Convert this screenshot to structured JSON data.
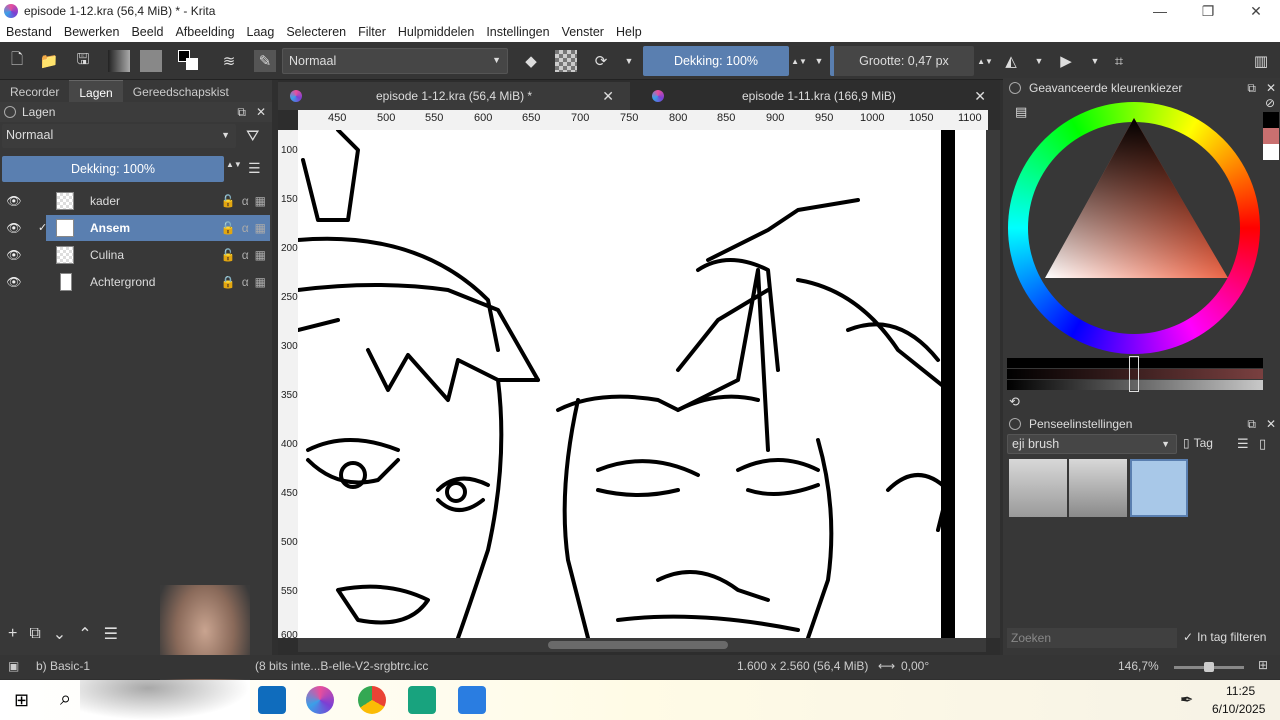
{
  "window": {
    "title": "episode 1-12.kra (56,4 MiB) * - Krita"
  },
  "menu": [
    "Bestand",
    "Bewerken",
    "Beeld",
    "Afbeelding",
    "Laag",
    "Selecteren",
    "Filter",
    "Hulpmiddelen",
    "Instellingen",
    "Venster",
    "Help"
  ],
  "toolbar": {
    "blend_mode": "Normaal",
    "opacity": "Dekking: 100%",
    "size": "Grootte: 0,47 px"
  },
  "left_dock": {
    "tabs": [
      "Recorder",
      "Lagen",
      "Gereedschapskist"
    ],
    "panel_title": "Lagen",
    "blend_mode": "Normaal",
    "opacity": "Dekking:  100%",
    "layers": [
      {
        "name": "kader",
        "selected": false
      },
      {
        "name": "Ansem",
        "selected": true
      },
      {
        "name": "Culina",
        "selected": false
      },
      {
        "name": "Achtergrond",
        "selected": false
      }
    ]
  },
  "canvas": {
    "tabs": [
      "episode 1-12.kra (56,4 MiB) *",
      "episode 1-11.kra (166,9 MiB)"
    ],
    "ruler_h": [
      "450",
      "500",
      "550",
      "600",
      "650",
      "700",
      "750",
      "800",
      "850",
      "900",
      "950",
      "1000",
      "1050",
      "1100"
    ],
    "ruler_v": [
      "100",
      "150",
      "200",
      "250",
      "300",
      "350",
      "400",
      "450",
      "500",
      "550",
      "600"
    ]
  },
  "right_dock": {
    "color_panel_title": "Geavanceerde kleurenkiezer",
    "brush_panel_title": "Penseelinstellingen",
    "brush_tag": "eji brush",
    "tag_label": "Tag",
    "search_placeholder": "Zoeken",
    "filter_label": "In tag filteren"
  },
  "status": {
    "brush": "b) Basic-1",
    "color_profile": "(8 bits inte...B-elle-V2-srgbtrc.icc",
    "dimensions": "1.600 x 2.560 (56,4 MiB)",
    "rotation": "0,00°",
    "zoom": "146,7%"
  },
  "taskbar": {
    "time": "11:25",
    "date": "6/10/2025"
  },
  "colors": {
    "accent": "#5a7fb0",
    "panel": "#383838",
    "hue_ring": "conic"
  }
}
